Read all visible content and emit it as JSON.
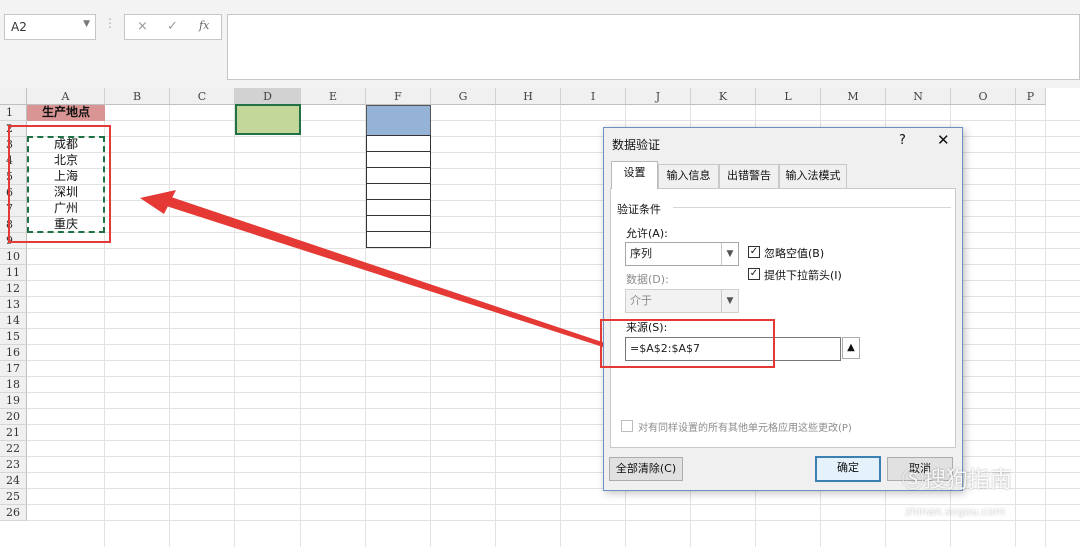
{
  "formula_bar": {
    "name_box": "A2",
    "fx_label": "fx",
    "cancel_glyph": "×",
    "enter_glyph": "✓",
    "formula": ""
  },
  "sheet": {
    "columns": [
      "A",
      "B",
      "C",
      "D",
      "E",
      "F",
      "G",
      "H",
      "I",
      "J",
      "K",
      "L",
      "M",
      "N",
      "O",
      "P"
    ],
    "rows": [
      "1",
      "2",
      "3",
      "4",
      "5",
      "6",
      "7",
      "8",
      "9",
      "10",
      "11",
      "12",
      "13",
      "14",
      "15",
      "16",
      "17",
      "18",
      "19",
      "20",
      "21",
      "22",
      "23",
      "24",
      "25",
      "26"
    ],
    "a1_header": "生产地点",
    "cities": [
      "成都",
      "北京",
      "上海",
      "深圳",
      "广州",
      "重庆"
    ],
    "colors": {
      "header_fill": "#d99594",
      "d_fill": "#c4d79b",
      "f_fill": "#95b3d7",
      "annotation": "#e53935"
    }
  },
  "dialog": {
    "title": "数据验证",
    "help": "?",
    "close": "✕",
    "tabs": [
      "设置",
      "输入信息",
      "出错警告",
      "输入法模式"
    ],
    "section": "验证条件",
    "allow_label": "允许(A):",
    "allow_value": "序列",
    "data_label": "数据(D):",
    "data_value": "介于",
    "ignore_blank": "忽略空值(B)",
    "dropdown": "提供下拉箭头(I)",
    "source_label": "来源(S):",
    "source_value": "=$A$2:$A$7",
    "apply_all": "对有同样设置的所有其他单元格应用这些更改(P)",
    "clear_all": "全部清除(C)",
    "ok": "确定",
    "cancel": "取消"
  },
  "watermark": {
    "text": "搜狗指南",
    "url": "zhinan.sogou.com"
  }
}
